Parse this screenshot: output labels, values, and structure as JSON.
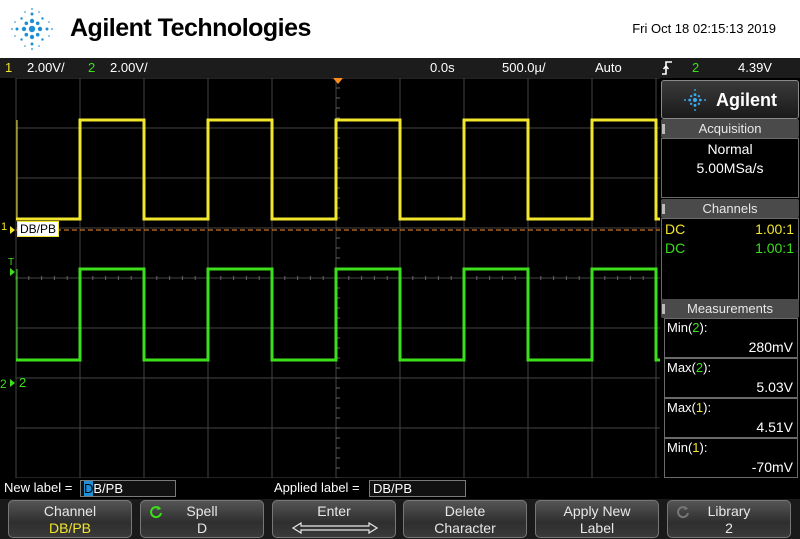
{
  "header": {
    "brand": "Agilent Technologies",
    "datetime": "Fri Oct 18 02:15:13 2019",
    "logo_icon": "agilent-spark-icon"
  },
  "statusbar": {
    "ch1_num": "1",
    "ch1_scale": "2.00V/",
    "ch2_num": "2",
    "ch2_scale": "2.00V/",
    "time_offset": "0.0s",
    "time_scale": "500.0µ/",
    "trigger_mode": "Auto",
    "trigger_icon": "rising-edge-icon",
    "trigger_source": "2",
    "trigger_level": "4.39V"
  },
  "screen": {
    "label_tag": "DB/PB",
    "ch1_marker": "1",
    "ch2_marker": "2",
    "trig_marker": "T"
  },
  "panel": {
    "brand": "Agilent",
    "acquisition": {
      "title": "Acquisition",
      "mode": "Normal",
      "rate": "5.00MSa/s"
    },
    "channels": {
      "title": "Channels",
      "rows": [
        {
          "coupling": "DC",
          "probe": "1.00:1"
        },
        {
          "coupling": "DC",
          "probe": "1.00:1"
        }
      ]
    },
    "measurements": {
      "title": "Measurements",
      "items": [
        {
          "label": "Min(2):",
          "value": "280mV"
        },
        {
          "label": "Max(2):",
          "value": "5.03V"
        },
        {
          "label": "Max(1):",
          "value": "4.51V"
        },
        {
          "label": "Min(1):",
          "value": "-70mV"
        }
      ]
    }
  },
  "labelbar": {
    "new_label_text": "New label =",
    "new_label_value_cursor": "D",
    "new_label_value_rest": "B/PB",
    "applied_label_text": "Applied label =",
    "applied_label_value": "DB/PB"
  },
  "softkeys": [
    {
      "line1": "Channel",
      "line2": "DB/PB"
    },
    {
      "line1": "Spell",
      "line2": "D"
    },
    {
      "line1": "Enter",
      "line2": ""
    },
    {
      "line1": "Delete",
      "line2": "Character"
    },
    {
      "line1": "Apply New",
      "line2": "Label"
    },
    {
      "line1": "Library",
      "line2": "2"
    }
  ],
  "colors": {
    "ch1": "#f2e62c",
    "ch2": "#3be01a",
    "trigger_marker": "#ff8c1a",
    "grid": "#444444"
  }
}
